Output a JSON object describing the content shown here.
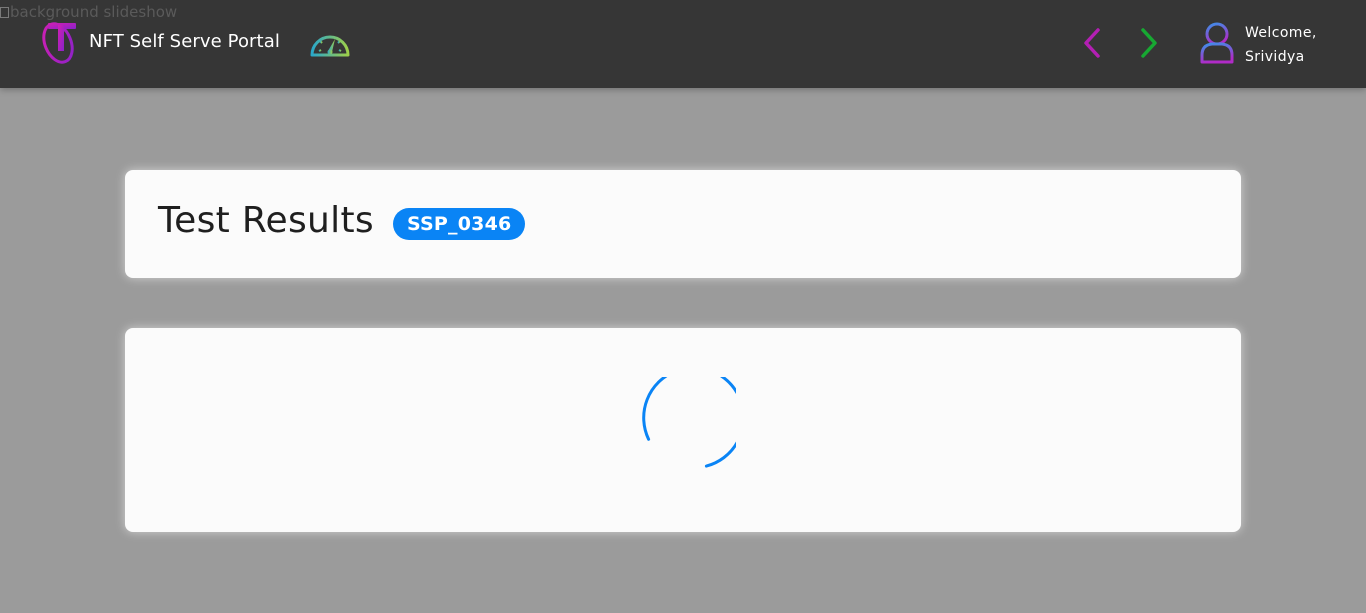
{
  "background": {
    "alt_text": "background slideshow"
  },
  "header": {
    "app_title": "NFT Self Serve Portal",
    "welcome_line1": "Welcome,",
    "welcome_line2": "Srividya",
    "icons": {
      "logo": "telstra-logo-icon",
      "dashboard": "speedometer-icon",
      "back": "chevron-left-icon",
      "forward": "chevron-right-icon",
      "user": "user-icon"
    },
    "colors": {
      "bar": "#363636",
      "back_arrow": "#b31fb3",
      "forward_arrow": "#17a832"
    }
  },
  "main": {
    "title": "Test Results",
    "badge": "SSP_0346",
    "badge_color": "#0a84f5",
    "loading": true
  }
}
